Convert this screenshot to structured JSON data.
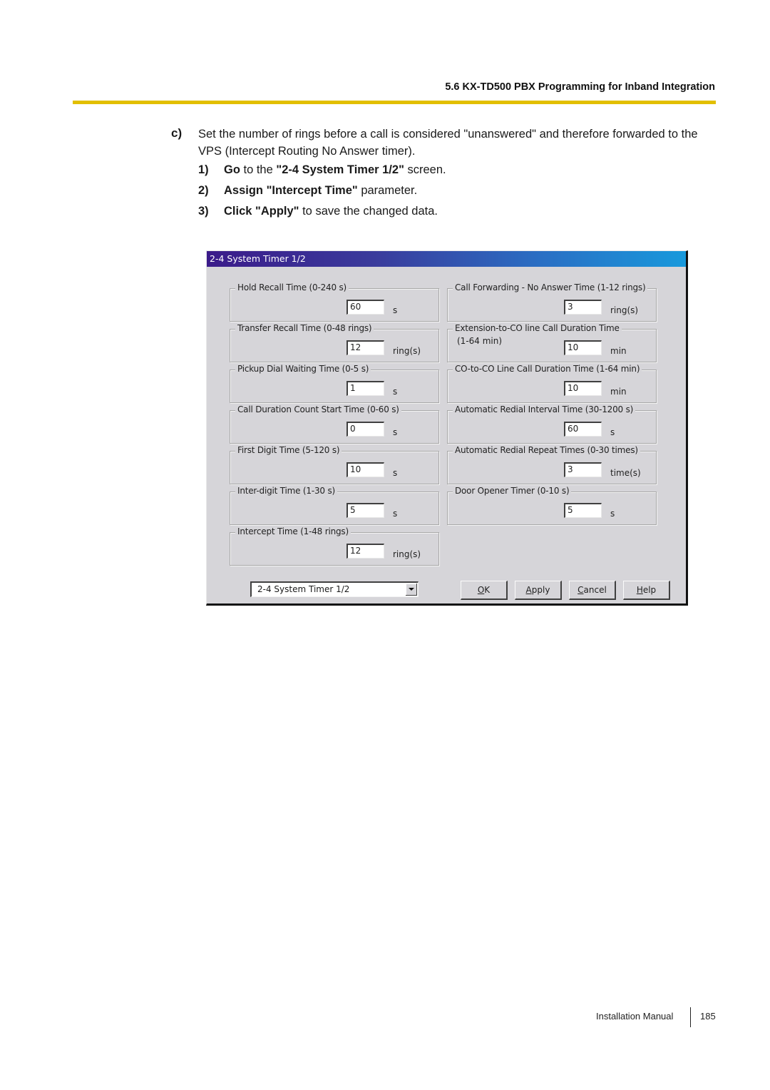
{
  "page": {
    "running_header": "5.6 KX-TD500 PBX Programming for Inband Integration",
    "header_rule_color": "#e2bf00",
    "step_marker": "c)",
    "intro": "Set the number of rings before a call is considered \"unanswered\" and therefore forwarded to the VPS (Intercept Routing No Answer timer).",
    "steps": [
      {
        "num": "1)",
        "bold1": "Go",
        "text1": " to the ",
        "bold2": "\"2-4 System Timer 1/2\"",
        "text2": " screen."
      },
      {
        "num": "2)",
        "bold1": "Assign \"Intercept Time\"",
        "text1": " parameter.",
        "bold2": "",
        "text2": ""
      },
      {
        "num": "3)",
        "bold1": "Click \"Apply\"",
        "text1": " to save the changed data.",
        "bold2": "",
        "text2": ""
      }
    ],
    "footer": {
      "label": "Installation Manual",
      "page_number": "185"
    }
  },
  "dialog": {
    "title": "2-4 System Timer 1/2",
    "left_groups": [
      {
        "label": "Hold Recall Time (0-240 s)",
        "value": "60",
        "unit": "s"
      },
      {
        "label": "Transfer Recall Time (0-48 rings)",
        "value": "12",
        "unit": "ring(s)"
      },
      {
        "label": "Pickup Dial Waiting Time (0-5 s)",
        "value": "1",
        "unit": "s"
      },
      {
        "label": "Call Duration Count Start Time (0-60 s)",
        "value": "0",
        "unit": "s"
      },
      {
        "label": "First Digit Time (5-120 s)",
        "value": "10",
        "unit": "s"
      },
      {
        "label": "Inter-digit Time (1-30 s)",
        "value": "5",
        "unit": "s"
      },
      {
        "label": "Intercept Time (1-48 rings)",
        "value": "12",
        "unit": "ring(s)"
      }
    ],
    "right_groups": [
      {
        "label": "Call Forwarding - No Answer Time (1-12 rings)",
        "label2": "",
        "value": "3",
        "unit": "ring(s)"
      },
      {
        "label": "Extension-to-CO line Call Duration Time",
        "label2": "(1-64 min)",
        "value": "10",
        "unit": "min"
      },
      {
        "label": "CO-to-CO Line Call Duration Time (1-64 min)",
        "label2": "",
        "value": "10",
        "unit": "min"
      },
      {
        "label": "Automatic Redial Interval Time (30-1200 s)",
        "label2": "",
        "value": "60",
        "unit": "s"
      },
      {
        "label": "Automatic Redial Repeat Times (0-30 times)",
        "label2": "",
        "value": "3",
        "unit": "time(s)"
      },
      {
        "label": "Door Opener Timer (0-10 s)",
        "label2": "",
        "value": "5",
        "unit": "s"
      }
    ],
    "screen_select": {
      "selected": "2-4 System Timer 1/2",
      "icon": "chevron-down-icon"
    },
    "buttons": {
      "ok": {
        "key": "O",
        "rest": "K"
      },
      "apply": {
        "key": "A",
        "rest": "pply"
      },
      "cancel": {
        "key": "C",
        "rest": "ancel"
      },
      "help": {
        "key": "H",
        "rest": "elp"
      }
    },
    "title_gradient": [
      "#3b1b8a",
      "#1899dc"
    ]
  }
}
